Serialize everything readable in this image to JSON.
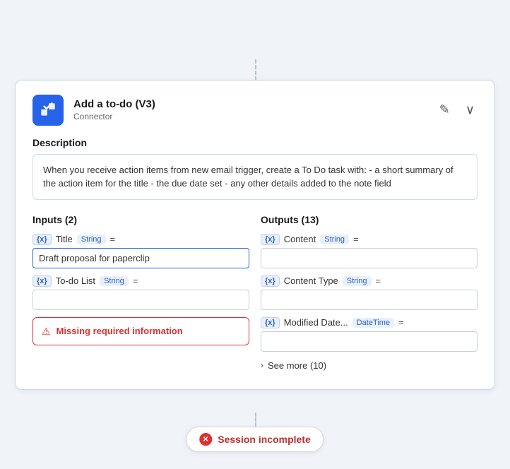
{
  "header": {
    "title": "Add a to-do (V3)",
    "subtitle": "Connector",
    "edit_icon": "✎",
    "chevron_icon": "∨"
  },
  "description": {
    "label": "Description",
    "text": "When you receive action items from new email trigger, create a To Do task with: - a short summary of the action item for the title - the due date set - any other details added to the note field"
  },
  "inputs": {
    "section_title": "Inputs (2)",
    "fields": [
      {
        "var_badge": "{x}",
        "name": "Title",
        "type": "String",
        "equals": "=",
        "value": "Draft proposal for paperclip",
        "has_value": true
      },
      {
        "var_badge": "{x}",
        "name": "To-do List",
        "type": "String",
        "equals": "=",
        "value": "",
        "has_value": false
      }
    ],
    "error": {
      "text": "Missing required information"
    }
  },
  "outputs": {
    "section_title": "Outputs (13)",
    "fields": [
      {
        "var_badge": "{x}",
        "name": "Content",
        "type": "String",
        "equals": "=",
        "value": ""
      },
      {
        "var_badge": "{x}",
        "name": "Content Type",
        "type": "String",
        "equals": "=",
        "value": ""
      },
      {
        "var_badge": "{x}",
        "name": "Modified Date...",
        "type": "DateTime",
        "equals": "=",
        "value": ""
      }
    ],
    "see_more": "See more (10)"
  },
  "session": {
    "text": "Session incomplete"
  }
}
